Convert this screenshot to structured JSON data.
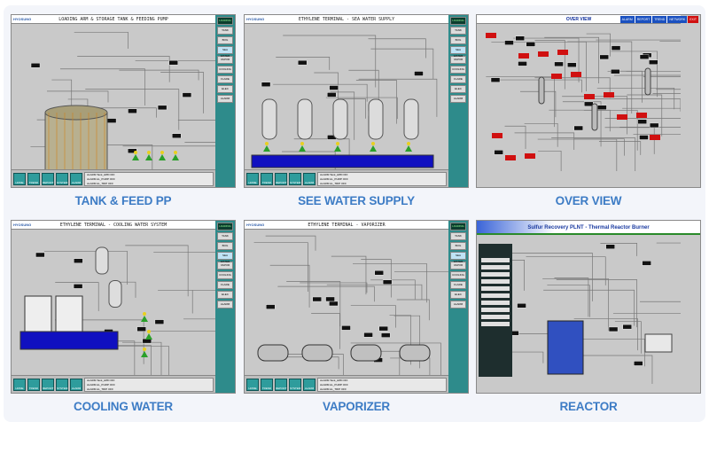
{
  "panels": [
    {
      "id": "tank",
      "title": "LOADING ARM & STORAGE TANK & FEEDING PUMP",
      "caption": "TANK & FEED PP",
      "logo": "HYOSUNG"
    },
    {
      "id": "sea",
      "title": "ETHYLENE TERMINAL - SEA WATER SUPPLY",
      "caption": "SEE WATER SUPPLY",
      "logo": "HYOSUNG"
    },
    {
      "id": "overview",
      "title": "OVER VIEW",
      "caption": "OVER VIEW",
      "logo": "",
      "buttons": [
        "ALARM",
        "REPORT",
        "TREND",
        "NETWORK",
        "EXIT"
      ]
    },
    {
      "id": "cooling",
      "title": "ETHYLENE TERMINAL - COOLING WATER SYSTEM",
      "caption": "COOLING WATER",
      "logo": "HYOSUNG"
    },
    {
      "id": "vaporizer",
      "title": "ETHYLENE TERMINAL - VAPORIZER",
      "caption": "VAPORIZER",
      "logo": "HYOSUNG"
    },
    {
      "id": "reactor",
      "title": "Sulfur Recovery PLNT - Thermal Reactor Burner",
      "caption": "REACTOR",
      "logo": ""
    }
  ],
  "footer_buttons": [
    "HOME",
    "TREND",
    "REPORT",
    "SYSTEM",
    "ALARM"
  ],
  "log_lines": [
    "ALARM Tank_H88 OFF",
    "ALARM AL_PUMP OFF",
    "ALARM AL_TRIP OFF"
  ],
  "side_buttons": [
    "LOADING",
    "TANK",
    "BOG",
    "SEA WATER",
    "VAPOR",
    "COOLING",
    "FLARE",
    "ELEC",
    "ALARM"
  ],
  "colors": {
    "caption": "#3d7cc5",
    "scada_bg": "#c9c9c9",
    "nav_teal": "#2e8b8b",
    "water": "#1010c0",
    "alarm_red": "#d01010"
  }
}
